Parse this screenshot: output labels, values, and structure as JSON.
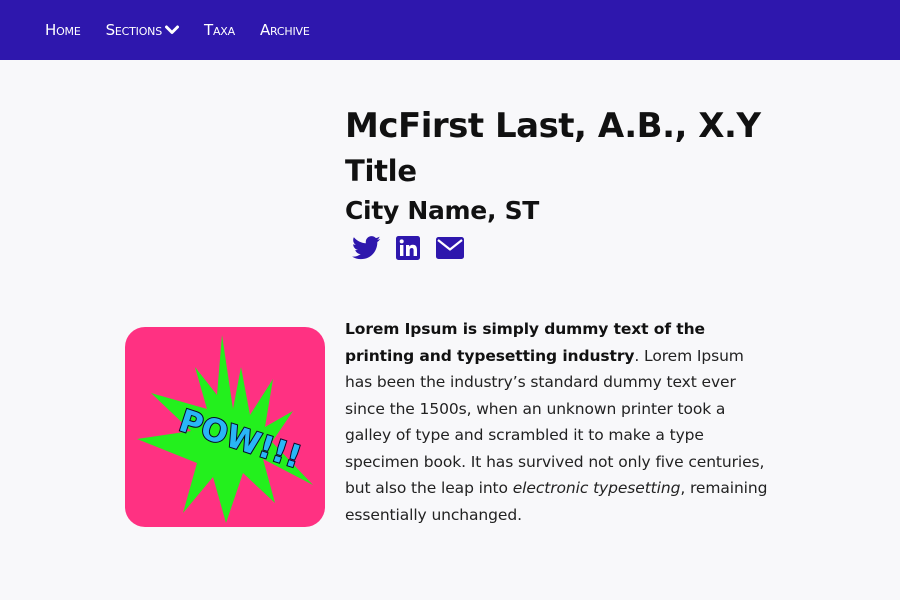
{
  "nav": {
    "items": [
      {
        "label": "Home"
      },
      {
        "label": "Sections"
      },
      {
        "label": "Taxa"
      },
      {
        "label": "Archive"
      }
    ]
  },
  "profile": {
    "name": "McFirst Last, A.B., X.Y",
    "title": "Title",
    "location": "City Name, ST",
    "socials": [
      {
        "icon": "twitter-icon"
      },
      {
        "icon": "linkedin-icon"
      },
      {
        "icon": "envelope-icon"
      }
    ]
  },
  "avatar": {
    "text": "POW!!!"
  },
  "bio": {
    "bold": "Lorem Ipsum is simply dummy text of the printing and typesetting industry",
    "part1": ". Lorem Ipsum has been the industry’s standard dummy text ever since the 1500s, when an unknown printer took a galley of type and scrambled it to make a type specimen book. It has survived not only five centuries, but also the leap into ",
    "italic": "electronic typesetting",
    "part2": ", remaining essentially unchanged."
  },
  "colors": {
    "nav_bg": "#2e17ad",
    "page_bg": "#f8f8fa",
    "accent": "#2e17ad",
    "avatar_bg": "#ff3182",
    "burst": "#23f01d"
  }
}
